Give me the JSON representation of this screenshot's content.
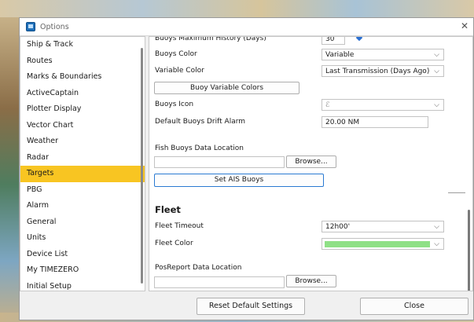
{
  "window": {
    "title": "Options",
    "close_glyph": "✕"
  },
  "sidebar": {
    "items": [
      {
        "label": "Ship & Track"
      },
      {
        "label": "Routes"
      },
      {
        "label": "Marks & Boundaries"
      },
      {
        "label": "ActiveCaptain"
      },
      {
        "label": "Plotter Display"
      },
      {
        "label": "Vector Chart"
      },
      {
        "label": "Weather"
      },
      {
        "label": "Radar"
      },
      {
        "label": "Targets",
        "selected": true
      },
      {
        "label": "PBG"
      },
      {
        "label": "Alarm"
      },
      {
        "label": "General"
      },
      {
        "label": "Units"
      },
      {
        "label": "Device List"
      },
      {
        "label": "My TIMEZERO"
      },
      {
        "label": "Initial Setup"
      }
    ]
  },
  "settings": {
    "buoys_max_history": {
      "label": "Buoys Maximum History (Days)",
      "value": "30"
    },
    "buoys_color": {
      "label": "Buoys Color",
      "value": "Variable"
    },
    "variable_color": {
      "label": "Variable Color",
      "value": "Last Transmission (Days Ago)"
    },
    "buoy_variable_colors_button": "Buoy Variable Colors",
    "buoys_icon": {
      "label": "Buoys Icon",
      "value": "ℰ"
    },
    "default_buoys_drift_alarm": {
      "label": "Default Buoys Drift Alarm",
      "value": "20.00 NM"
    },
    "fish_buoys_data_location": {
      "label": "Fish Buoys Data Location",
      "value": "",
      "browse": "Browse..."
    },
    "set_ais_buoys_button": "Set AIS Buoys",
    "fleet": {
      "heading": "Fleet",
      "timeout": {
        "label": "Fleet Timeout",
        "value": "12h00'"
      },
      "color": {
        "label": "Fleet Color",
        "value": "#8fe086"
      }
    },
    "posreport_data_location": {
      "label": "PosReport Data Location",
      "value": "",
      "browse": "Browse..."
    }
  },
  "footer": {
    "reset_label": "Reset Default Settings",
    "close_label": "Close"
  },
  "icons": {
    "dropdown": "chevron-down-icon",
    "app": "options-window-icon"
  }
}
